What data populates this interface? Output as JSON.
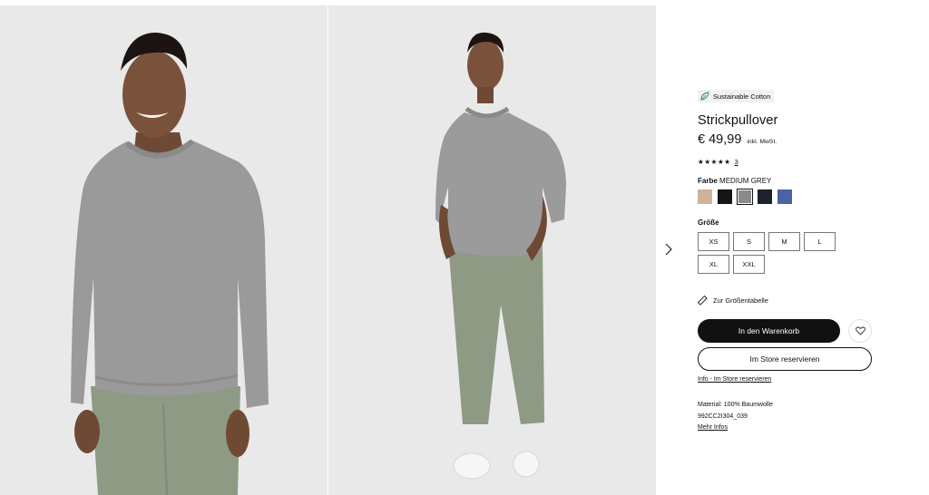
{
  "gallery": {
    "image_left_alt": "Model in grauem Strickpullover, Nahaufnahme",
    "image_right_alt": "Model in grauem Strickpullover, Ganzkörper",
    "next_icon": "chevron-right-icon"
  },
  "product": {
    "badge": "Sustainable Cotton",
    "badge_icon": "leaf-icon",
    "title": "Strickpullover",
    "price": "€ 49,99",
    "vat_note": "inkl. MwSt.",
    "stars": "★★★★★",
    "rating_count": "3",
    "color_label": "Farbe",
    "color_value": "MEDIUM GREY",
    "swatches": [
      {
        "name": "beige",
        "color": "#cfb29a"
      },
      {
        "name": "black",
        "color": "#151515"
      },
      {
        "name": "medium-grey",
        "color": "#8b8b8b",
        "selected": true
      },
      {
        "name": "navy",
        "color": "#1e2130"
      },
      {
        "name": "blue",
        "color": "#4c62a3"
      }
    ],
    "size_label": "Größe",
    "sizes": [
      "XS",
      "S",
      "M",
      "L",
      "XL",
      "XXL"
    ],
    "size_chart_link": "Zur Größentabelle",
    "add_to_cart": "In den Warenkorb",
    "reserve_in_store": "Im Store reservieren",
    "store_info_link": "Info - Im Store reservieren",
    "material": "Material: 100% Baumwolle",
    "article_number": "992CC2I304_039",
    "more_info": "Mehr Infos"
  }
}
